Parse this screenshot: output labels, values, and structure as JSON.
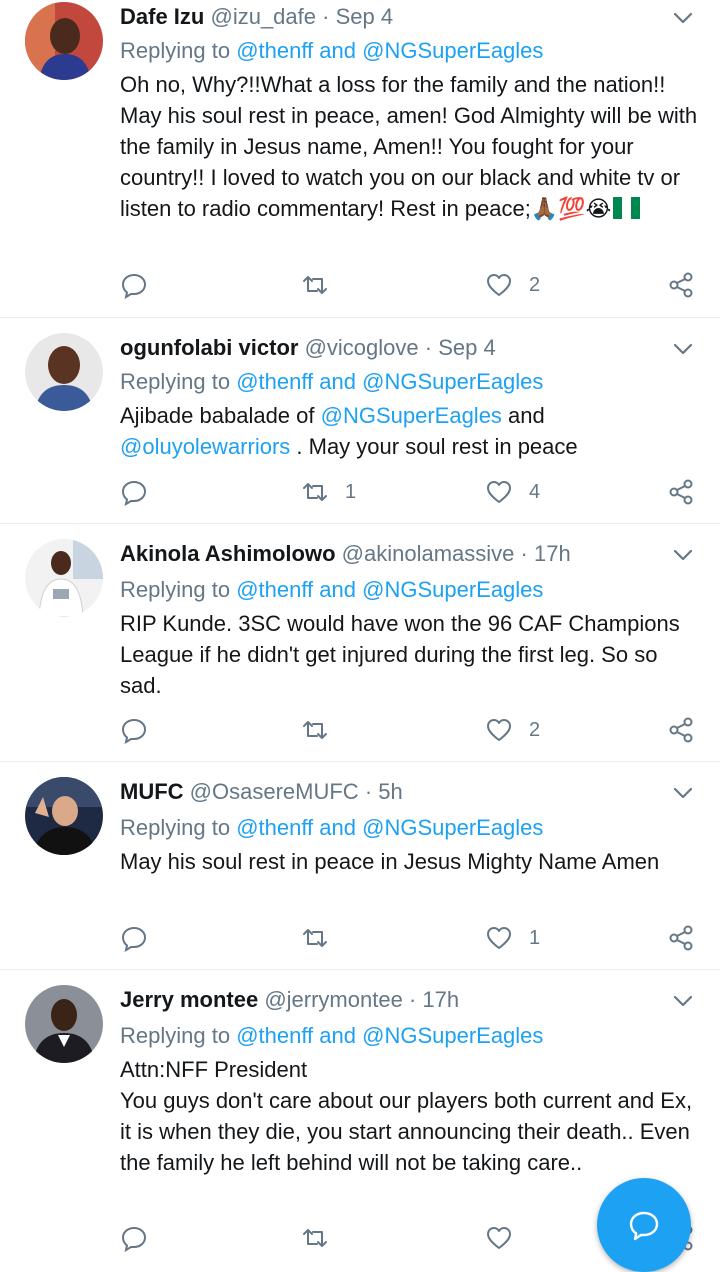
{
  "tweets": [
    {
      "name": "Dafe Izu",
      "handle": "@izu_dafe",
      "dot": "·",
      "time": "Sep 4",
      "replying_prefix": "Replying to ",
      "mention1": "@thenff",
      "and": " and ",
      "mention2": "@NGSuperEagles",
      "text": "Oh no, Why?!!What a loss for the family and the nation!! May his soul rest in peace, amen! God Almighty will be with the family in Jesus name, Amen!! You fought for your country!! I loved to watch you on our black and white tv or listen to radio commentary! Rest in peace;",
      "emoji": "🙏🏾💯😭",
      "reply_count": "",
      "retweet_count": "",
      "like_count": "2"
    },
    {
      "name": "ogunfolabi victor",
      "handle": "@vicoglove",
      "dot": "·",
      "time": "Sep 4",
      "replying_prefix": "Replying to ",
      "mention1": "@thenff",
      "and": " and ",
      "mention2": "@NGSuperEagles",
      "text_a": "Ajibade babalade of ",
      "text_link1": "@NGSuperEagles",
      "text_b": " and",
      "text_link2": "@oluyolewarriors",
      "text_c": " . May your soul rest in peace",
      "reply_count": "",
      "retweet_count": "1",
      "like_count": "4"
    },
    {
      "name": "Akinola Ashimolowo",
      "handle": "@akinolamassive",
      "dot": "·",
      "time": "17h",
      "replying_prefix": "Replying to ",
      "mention1": "@thenff",
      "and": " and ",
      "mention2": "@NGSuperEagles",
      "text": "RIP Kunde. 3SC would have won the 96 CAF Champions League if he didn't get injured during the first leg. So so sad.",
      "reply_count": "",
      "retweet_count": "",
      "like_count": "2"
    },
    {
      "name": "MUFC",
      "handle": "@OsasereMUFC",
      "dot": "·",
      "time": "5h",
      "replying_prefix": "Replying to ",
      "mention1": "@thenff",
      "and": " and ",
      "mention2": "@NGSuperEagles",
      "text": "May his soul rest in peace in Jesus Mighty Name Amen",
      "reply_count": "",
      "retweet_count": "",
      "like_count": "1"
    },
    {
      "name": "Jerry montee",
      "handle": "@jerrymontee",
      "dot": "·",
      "time": "17h",
      "replying_prefix": "Replying to ",
      "mention1": "@thenff",
      "and": " and ",
      "mention2": "@NGSuperEagles",
      "text_line1": "Attn:NFF President",
      "text": "You guys don't care about our players both current and Ex, it is when they die, you start announcing their death.. Even the family he left behind will not be taking care..",
      "reply_count": "",
      "retweet_count": "",
      "like_count": ""
    }
  ],
  "colors": {
    "accent": "#1da1f2",
    "muted": "#657786",
    "text": "#14171a",
    "divider": "#e6ecf0",
    "flag_green": "#008751"
  },
  "icons": {
    "reply": "reply-icon",
    "retweet": "retweet-icon",
    "like": "heart-icon",
    "share": "share-icon",
    "more": "chevron-down-icon",
    "compose": "compose-reply-icon"
  }
}
